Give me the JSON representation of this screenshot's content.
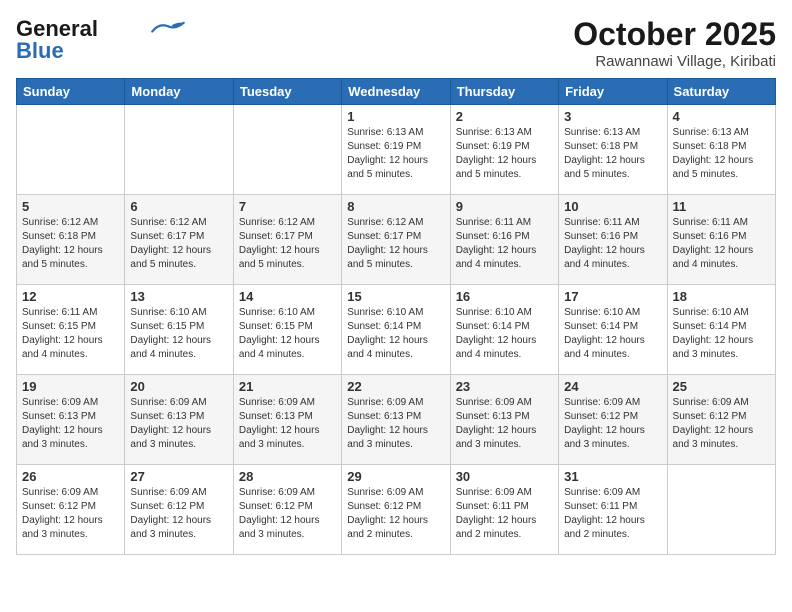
{
  "header": {
    "logo_general": "General",
    "logo_blue": "Blue",
    "month_title": "October 2025",
    "subtitle": "Rawannawi Village, Kiribati"
  },
  "days_of_week": [
    "Sunday",
    "Monday",
    "Tuesday",
    "Wednesday",
    "Thursday",
    "Friday",
    "Saturday"
  ],
  "weeks": [
    {
      "days": [
        {
          "num": "",
          "info": ""
        },
        {
          "num": "",
          "info": ""
        },
        {
          "num": "",
          "info": ""
        },
        {
          "num": "1",
          "info": "Sunrise: 6:13 AM\nSunset: 6:19 PM\nDaylight: 12 hours\nand 5 minutes."
        },
        {
          "num": "2",
          "info": "Sunrise: 6:13 AM\nSunset: 6:19 PM\nDaylight: 12 hours\nand 5 minutes."
        },
        {
          "num": "3",
          "info": "Sunrise: 6:13 AM\nSunset: 6:18 PM\nDaylight: 12 hours\nand 5 minutes."
        },
        {
          "num": "4",
          "info": "Sunrise: 6:13 AM\nSunset: 6:18 PM\nDaylight: 12 hours\nand 5 minutes."
        }
      ]
    },
    {
      "days": [
        {
          "num": "5",
          "info": "Sunrise: 6:12 AM\nSunset: 6:18 PM\nDaylight: 12 hours\nand 5 minutes."
        },
        {
          "num": "6",
          "info": "Sunrise: 6:12 AM\nSunset: 6:17 PM\nDaylight: 12 hours\nand 5 minutes."
        },
        {
          "num": "7",
          "info": "Sunrise: 6:12 AM\nSunset: 6:17 PM\nDaylight: 12 hours\nand 5 minutes."
        },
        {
          "num": "8",
          "info": "Sunrise: 6:12 AM\nSunset: 6:17 PM\nDaylight: 12 hours\nand 5 minutes."
        },
        {
          "num": "9",
          "info": "Sunrise: 6:11 AM\nSunset: 6:16 PM\nDaylight: 12 hours\nand 4 minutes."
        },
        {
          "num": "10",
          "info": "Sunrise: 6:11 AM\nSunset: 6:16 PM\nDaylight: 12 hours\nand 4 minutes."
        },
        {
          "num": "11",
          "info": "Sunrise: 6:11 AM\nSunset: 6:16 PM\nDaylight: 12 hours\nand 4 minutes."
        }
      ]
    },
    {
      "days": [
        {
          "num": "12",
          "info": "Sunrise: 6:11 AM\nSunset: 6:15 PM\nDaylight: 12 hours\nand 4 minutes."
        },
        {
          "num": "13",
          "info": "Sunrise: 6:10 AM\nSunset: 6:15 PM\nDaylight: 12 hours\nand 4 minutes."
        },
        {
          "num": "14",
          "info": "Sunrise: 6:10 AM\nSunset: 6:15 PM\nDaylight: 12 hours\nand 4 minutes."
        },
        {
          "num": "15",
          "info": "Sunrise: 6:10 AM\nSunset: 6:14 PM\nDaylight: 12 hours\nand 4 minutes."
        },
        {
          "num": "16",
          "info": "Sunrise: 6:10 AM\nSunset: 6:14 PM\nDaylight: 12 hours\nand 4 minutes."
        },
        {
          "num": "17",
          "info": "Sunrise: 6:10 AM\nSunset: 6:14 PM\nDaylight: 12 hours\nand 4 minutes."
        },
        {
          "num": "18",
          "info": "Sunrise: 6:10 AM\nSunset: 6:14 PM\nDaylight: 12 hours\nand 3 minutes."
        }
      ]
    },
    {
      "days": [
        {
          "num": "19",
          "info": "Sunrise: 6:09 AM\nSunset: 6:13 PM\nDaylight: 12 hours\nand 3 minutes."
        },
        {
          "num": "20",
          "info": "Sunrise: 6:09 AM\nSunset: 6:13 PM\nDaylight: 12 hours\nand 3 minutes."
        },
        {
          "num": "21",
          "info": "Sunrise: 6:09 AM\nSunset: 6:13 PM\nDaylight: 12 hours\nand 3 minutes."
        },
        {
          "num": "22",
          "info": "Sunrise: 6:09 AM\nSunset: 6:13 PM\nDaylight: 12 hours\nand 3 minutes."
        },
        {
          "num": "23",
          "info": "Sunrise: 6:09 AM\nSunset: 6:13 PM\nDaylight: 12 hours\nand 3 minutes."
        },
        {
          "num": "24",
          "info": "Sunrise: 6:09 AM\nSunset: 6:12 PM\nDaylight: 12 hours\nand 3 minutes."
        },
        {
          "num": "25",
          "info": "Sunrise: 6:09 AM\nSunset: 6:12 PM\nDaylight: 12 hours\nand 3 minutes."
        }
      ]
    },
    {
      "days": [
        {
          "num": "26",
          "info": "Sunrise: 6:09 AM\nSunset: 6:12 PM\nDaylight: 12 hours\nand 3 minutes."
        },
        {
          "num": "27",
          "info": "Sunrise: 6:09 AM\nSunset: 6:12 PM\nDaylight: 12 hours\nand 3 minutes."
        },
        {
          "num": "28",
          "info": "Sunrise: 6:09 AM\nSunset: 6:12 PM\nDaylight: 12 hours\nand 3 minutes."
        },
        {
          "num": "29",
          "info": "Sunrise: 6:09 AM\nSunset: 6:12 PM\nDaylight: 12 hours\nand 2 minutes."
        },
        {
          "num": "30",
          "info": "Sunrise: 6:09 AM\nSunset: 6:11 PM\nDaylight: 12 hours\nand 2 minutes."
        },
        {
          "num": "31",
          "info": "Sunrise: 6:09 AM\nSunset: 6:11 PM\nDaylight: 12 hours\nand 2 minutes."
        },
        {
          "num": "",
          "info": ""
        }
      ]
    }
  ]
}
